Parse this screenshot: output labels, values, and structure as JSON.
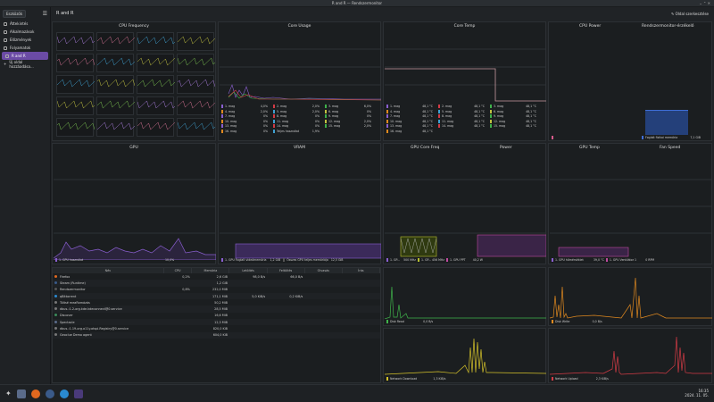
{
  "window": {
    "title": "R and R — Rendszermonitor"
  },
  "sidebar": {
    "dropdown": "Eszközök",
    "items": [
      {
        "label": "Áttekintés",
        "icon": "overview-icon"
      },
      {
        "label": "Alkalmazások",
        "icon": "applications-icon"
      },
      {
        "label": "Előzmények",
        "icon": "history-icon"
      },
      {
        "label": "Folyamatok",
        "icon": "processes-icon"
      },
      {
        "label": "R and R",
        "icon": "page-icon"
      },
      {
        "label": "Új oldal hozzáadása...",
        "icon": "add-icon"
      }
    ]
  },
  "header": {
    "title": "R and R",
    "edit": "Oldal szerkesztése"
  },
  "panels": {
    "cpu_freq": {
      "title": "CPU Frequency"
    },
    "core_usage": {
      "title": "Core Usage",
      "legend": [
        [
          "1. mag",
          "4,0%",
          "2. mag",
          "2,0%",
          "3. mag",
          "6,0%"
        ],
        [
          "4. mag",
          "2,0%",
          "5. mag",
          "2,0%",
          "6. mag",
          "0%"
        ],
        [
          "7. mag",
          "0%",
          "8. mag",
          "0%",
          "9. mag",
          "0%"
        ],
        [
          "10. mag",
          "0%",
          "11. mag",
          "0%",
          "12. mag",
          "2,0%"
        ],
        [
          "13. mag",
          "0%",
          "14. mag",
          "0%",
          "15. mag",
          "2,0%"
        ],
        [
          "16. mag",
          "0%",
          "Teljes használat",
          "1,9%",
          "",
          ""
        ]
      ]
    },
    "core_temp": {
      "title": "Core Temp",
      "legend": [
        [
          "1. mag",
          "48,1 °C",
          "2. mag",
          "48,1 °C",
          "3. mag",
          "48,1 °C"
        ],
        [
          "4. mag",
          "48,1 °C",
          "5. mag",
          "48,1 °C",
          "6. mag",
          "48,1 °C"
        ],
        [
          "7. mag",
          "48,1 °C",
          "8. mag",
          "48,1 °C",
          "9. mag",
          "48,1 °C"
        ],
        [
          "10. mag",
          "48,1 °C",
          "11. mag",
          "48,1 °C",
          "12. mag",
          "48,1 °C"
        ],
        [
          "13. mag",
          "48,1 °C",
          "14. mag",
          "48,1 °C",
          "15. mag",
          "48,1 °C"
        ],
        [
          "16. mag",
          "48,1 °C",
          "",
          "",
          "",
          ""
        ]
      ]
    },
    "cpu_power": {
      "title": "CPU Power"
    },
    "sysmon": {
      "title": "Rendszermonitor-érzékelő",
      "legend": "Foglalt fizikai memória",
      "value": "7,1 GiB"
    },
    "gpu": {
      "title": "GPU",
      "legend": "1. GPU használat",
      "value": "10,0%"
    },
    "vram": {
      "title": "VRAM",
      "legend": "1. GPU Foglalt videómemória",
      "value": "1,2 GiB",
      "legend2": "Összes GPU teljes memóriája",
      "value2": "12,5 GiB"
    },
    "gpu_freq": {
      "title": "GPU Core Freq",
      "legend": "1. GP...",
      "value": "500 MHz",
      "legend2": "1. GP...",
      "value2": "456 MHz"
    },
    "power": {
      "title": "Power",
      "legend": "1. GPU PPT",
      "value": "40,2 W"
    },
    "gpu_temp": {
      "title": "GPU Temp",
      "legend": "1. GPU hőmérséklet",
      "value": "39,0 °C"
    },
    "fan": {
      "title": "Fan Speed",
      "legend": "1. GPU Ventilátor 1",
      "value": "0 RPM"
    }
  },
  "proc_table": {
    "headers": [
      "Név",
      "CPU",
      "Memória",
      "Letöltés",
      "Feltöltés",
      "Olvasás",
      "Írás"
    ],
    "rows": [
      [
        "Firefox",
        "0,2%",
        "2,6 GiB",
        "98,0 B/s",
        "66,0 B/s",
        "",
        ""
      ],
      [
        "Steam (Runtime)",
        "",
        "1,2 GiB",
        "",
        "",
        "",
        ""
      ],
      [
        "Rendszermonitor",
        "0,8%",
        "232,0 MiB",
        "",
        "",
        "",
        ""
      ],
      [
        "qBittorrent",
        "",
        "171,1 MiB",
        "5,0 KiB/s",
        "0,2 KiB/s",
        "",
        ""
      ],
      [
        "Töltsé meaRamázás",
        "",
        "50,2 MiB",
        "",
        "",
        "",
        ""
      ],
      [
        "dbus-:1.2-org.kde.kdeconnect@0.service",
        "",
        "28,5 MiB",
        "",
        "",
        "",
        ""
      ],
      [
        "Discover",
        "",
        "16,6 MiB",
        "",
        "",
        "",
        ""
      ],
      [
        "Spectacle",
        "",
        "12,3 MiB",
        "",
        "",
        "",
        ""
      ],
      [
        "dbus-:1.19-org.a11y.atspi.Registry@0.service",
        "",
        "820,0 KiB",
        "",
        "",
        "",
        ""
      ],
      [
        "Geoclue Demo agent",
        "",
        "604,0 KiB",
        "",
        "",
        "",
        ""
      ]
    ]
  },
  "net": {
    "disk_read": "Disk Read",
    "disk_read_v": "0,0 B/s",
    "disk_write": "Disk Write",
    "disk_write_v": "0,0 B/s",
    "download": "Network Download",
    "download_v": "1,3 KiB/s",
    "upload": "Network Upload",
    "upload_v": "2,3 KiB/s"
  },
  "clock": {
    "time": "16:35",
    "date": "2024. 11. 05."
  },
  "colors": {
    "accent": "#6b4ba5",
    "green": "#3fb24a",
    "orange": "#e0891f",
    "yellow": "#d4c22a",
    "red": "#d23b45",
    "purple": "#8a5fd0"
  }
}
